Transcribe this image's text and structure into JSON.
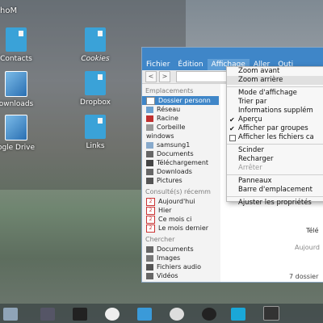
{
  "desktop": {
    "folder_title": "hoM",
    "icons": [
      {
        "label": "Contacts",
        "italic": false
      },
      {
        "label": "Cookies",
        "italic": true
      },
      {
        "label": "ownloads",
        "italic": false
      },
      {
        "label": "Dropbox",
        "italic": false
      },
      {
        "label": "ogle Drive",
        "italic": false
      },
      {
        "label": "Links",
        "italic": false
      }
    ]
  },
  "window": {
    "menus": [
      "Fichier",
      "Édition",
      "Affichage",
      "Aller",
      "Outi"
    ],
    "active_menu": "Affichage",
    "sidebar": {
      "sections": {
        "places": "Emplacements",
        "recent": "Consulté(s) récemm",
        "search": "Chercher"
      },
      "places": [
        "Dossier personn",
        "Réseau",
        "Racine",
        "Corbeille",
        "windows",
        "samsung1",
        "Documents",
        "Téléchargement",
        "Downloads",
        "Pictures"
      ],
      "recent": [
        "Aujourd'hui",
        "Hier",
        "Ce mois ci",
        "Le mois dernier"
      ],
      "search": [
        "Documents",
        "Images",
        "Fichiers audio",
        "Vidéos"
      ]
    },
    "content_fragments": {
      "a": "Télé",
      "b": "Aujourd",
      "status": "7 dossier"
    }
  },
  "view_menu": {
    "items": [
      {
        "label": "Zoom avant",
        "type": "item"
      },
      {
        "label": "Zoom arrière",
        "type": "item",
        "highlight": true
      },
      {
        "type": "sep"
      },
      {
        "label": "Mode d'affichage",
        "type": "item"
      },
      {
        "label": "Trier par",
        "type": "item"
      },
      {
        "label": "Informations supplém",
        "type": "item"
      },
      {
        "label": "Aperçu",
        "type": "check",
        "checked": true
      },
      {
        "label": "Afficher par groupes",
        "type": "check",
        "checked": true
      },
      {
        "label": "Afficher les fichiers ca",
        "type": "box"
      },
      {
        "type": "sep"
      },
      {
        "label": "Scinder",
        "type": "item"
      },
      {
        "label": "Recharger",
        "type": "item"
      },
      {
        "label": "Arrêter",
        "type": "item",
        "disabled": true
      },
      {
        "type": "sep"
      },
      {
        "label": "Panneaux",
        "type": "item"
      },
      {
        "label": "Barre d'emplacement",
        "type": "item"
      },
      {
        "type": "sep"
      },
      {
        "label": "Ajuster les propriétés",
        "type": "item"
      }
    ]
  }
}
